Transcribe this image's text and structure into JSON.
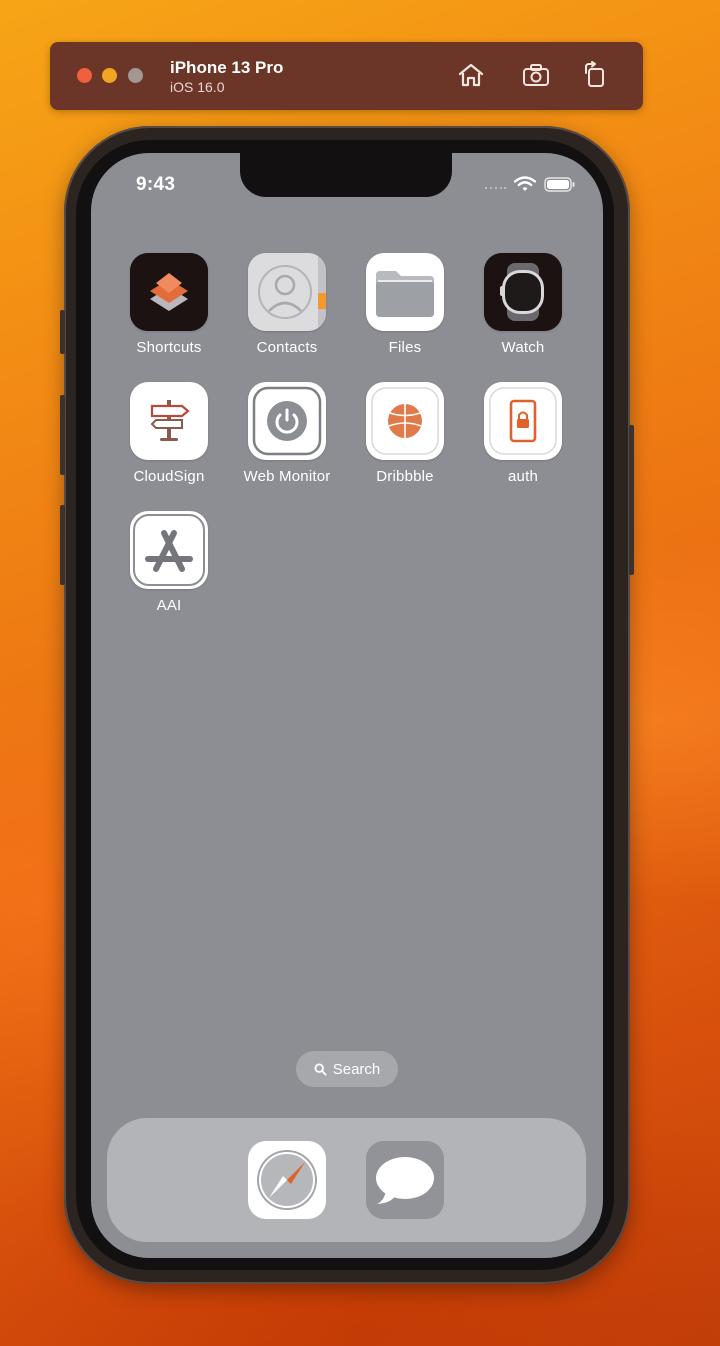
{
  "toolbar": {
    "device_name": "iPhone 13 Pro",
    "os_version": "iOS 16.0",
    "buttons": [
      {
        "name": "home-icon"
      },
      {
        "name": "screenshot-icon"
      },
      {
        "name": "rotate-icon"
      }
    ]
  },
  "status_bar": {
    "time": "9:43",
    "icons": [
      "cellular-icon",
      "wifi-icon",
      "battery-icon"
    ]
  },
  "apps": [
    {
      "label": "Shortcuts",
      "icon": "shortcuts-icon"
    },
    {
      "label": "Contacts",
      "icon": "contacts-icon"
    },
    {
      "label": "Files",
      "icon": "files-icon"
    },
    {
      "label": "Watch",
      "icon": "watch-icon"
    },
    {
      "label": "CloudSign",
      "icon": "signpost-icon"
    },
    {
      "label": "Web Monitor",
      "icon": "power-icon"
    },
    {
      "label": "Dribbble",
      "icon": "basketball-icon"
    },
    {
      "label": "auth",
      "icon": "lock-icon"
    },
    {
      "label": "AAI",
      "icon": "app-store-icon"
    }
  ],
  "search": {
    "label": "Search",
    "icon": "search-icon"
  },
  "dock": [
    {
      "name": "safari-icon"
    },
    {
      "name": "messages-icon"
    }
  ],
  "colors": {
    "screen_bg": "#8c8e93",
    "toolbar_bg": "#6b3528",
    "accent_orange": "#e0622a"
  }
}
